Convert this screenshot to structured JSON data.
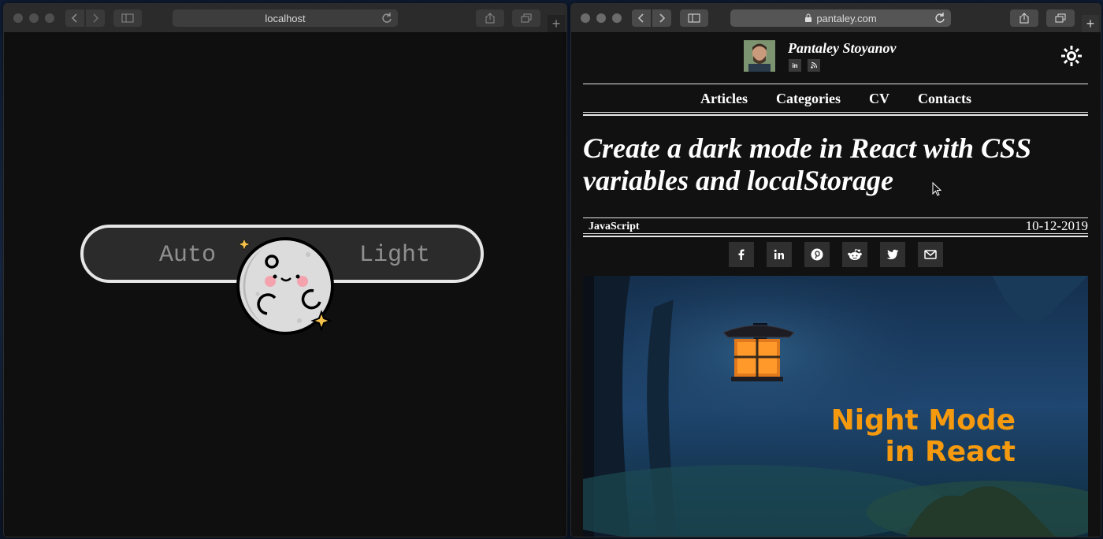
{
  "left_window": {
    "url": "localhost",
    "toggle": {
      "left_label": "Auto",
      "right_label": "Light"
    }
  },
  "right_window": {
    "url": "pantaley.com",
    "author": "Pantaley Stoyanov",
    "social": [
      "in",
      "rss"
    ],
    "nav": [
      "Articles",
      "Categories",
      "CV",
      "Contacts"
    ],
    "article": {
      "title_line1": "Create a dark mode in React with CSS",
      "title_line2": "variables and localStorage",
      "category": "JavaScript",
      "date": "10-12-2019"
    },
    "share": [
      "facebook-icon",
      "linkedin-icon",
      "pinterest-icon",
      "reddit-icon",
      "twitter-icon",
      "email-icon"
    ],
    "hero": {
      "line1": "Night Mode",
      "line2": "in React",
      "text_color": "#f59a0e"
    }
  }
}
